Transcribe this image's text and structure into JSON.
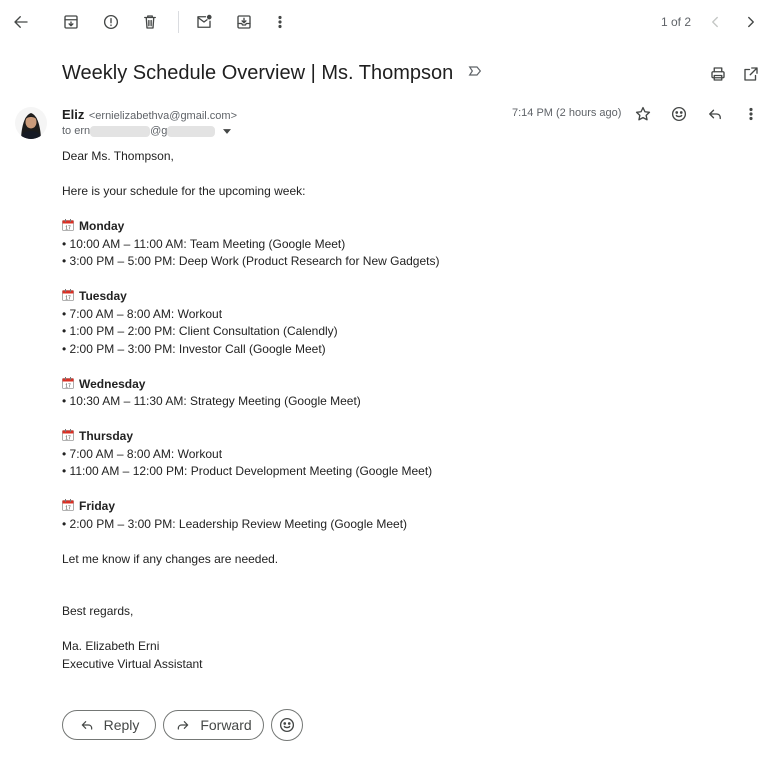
{
  "toolbar": {
    "page_indicator": "1 of 2",
    "icons": [
      "back-arrow-icon",
      "archive-icon",
      "report-spam-icon",
      "delete-icon",
      "mark-unread-icon",
      "move-to-icon",
      "more-options-icon",
      "prev-icon",
      "next-icon"
    ]
  },
  "email": {
    "subject": "Weekly Schedule Overview | Ms. Thompson",
    "sender_name": "Eliz",
    "sender_email": "<ernielizabethva@gmail.com>",
    "to_prefix": "to ern",
    "to_at": "@g",
    "timestamp": "7:14 PM (2 hours ago)",
    "greeting": "Dear Ms. Thompson,",
    "intro": "Here is your schedule for the upcoming week:",
    "days": [
      {
        "name": "Monday",
        "items": [
          "• 10:00 AM – 11:00 AM: Team Meeting (Google Meet)",
          "• 3:00 PM – 5:00 PM: Deep Work (Product Research for New Gadgets)"
        ]
      },
      {
        "name": "Tuesday",
        "items": [
          "• 7:00 AM – 8:00 AM: Workout",
          "• 1:00 PM – 2:00 PM: Client Consultation (Calendly)",
          "• 2:00 PM – 3:00 PM: Investor Call (Google Meet)"
        ]
      },
      {
        "name": "Wednesday",
        "items": [
          "• 10:30 AM – 11:30 AM: Strategy Meeting (Google Meet)"
        ]
      },
      {
        "name": "Thursday",
        "items": [
          "• 7:00 AM – 8:00 AM: Workout",
          "• 11:00 AM – 12:00 PM: Product Development Meeting (Google Meet)"
        ]
      },
      {
        "name": "Friday",
        "items": [
          "• 2:00 PM – 3:00 PM: Leadership Review Meeting (Google Meet)"
        ]
      }
    ],
    "closing_line": "Let me know if any changes are needed.",
    "signoff": "Best regards,",
    "signature_name": "Ma. Elizabeth Erni",
    "signature_title": "Executive Virtual Assistant",
    "calendar_emoji_color": "#d93025"
  },
  "actions": {
    "reply_label": "Reply",
    "forward_label": "Forward"
  }
}
